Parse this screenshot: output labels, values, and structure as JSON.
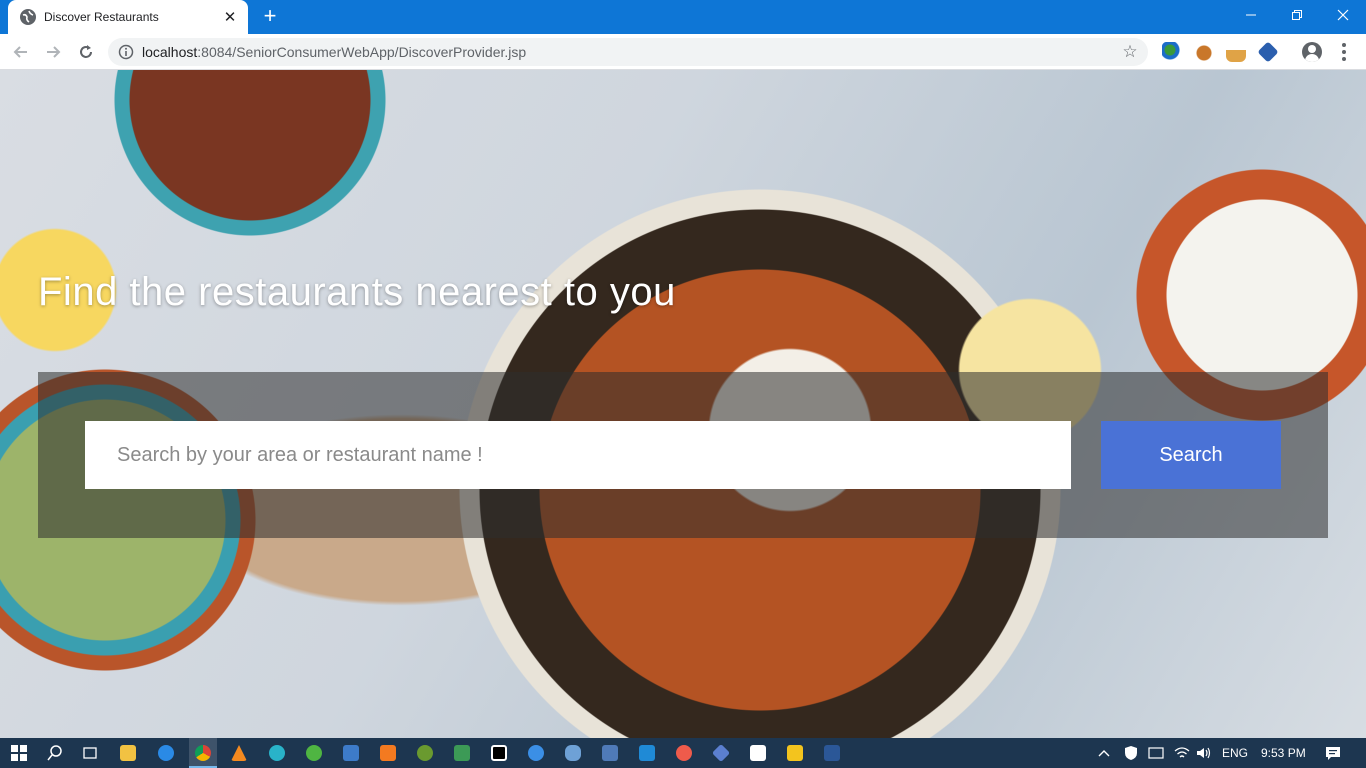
{
  "browser": {
    "tab_title": "Discover Restaurants",
    "url_host": "localhost",
    "url_rest": ":8084/SeniorConsumerWebApp/DiscoverProvider.jsp",
    "close_glyph": "✕",
    "new_tab_glyph": "+",
    "minimize_glyph": "—",
    "maximize_glyph": "❐",
    "window_close_glyph": "✕",
    "star_glyph": "☆"
  },
  "page": {
    "heading": "Find the restaurants nearest to you",
    "search_placeholder": "Search by your area or restaurant name !",
    "search_value": "",
    "search_button_label": "Search",
    "accent_color": "#4a72d6"
  },
  "taskbar": {
    "apps": [
      "windows-start-icon",
      "search-icon",
      "task-view-icon",
      "file-explorer-icon",
      "edge-icon",
      "chrome-icon",
      "vlc-icon",
      "app-icon",
      "app-icon",
      "virtualbox-icon",
      "xampp-icon",
      "app-icon",
      "app-icon",
      "intellij-icon",
      "app-icon",
      "postgres-icon",
      "app-icon",
      "vscode-icon",
      "app-icon",
      "app-icon",
      "app-icon",
      "app-icon",
      "word-icon"
    ],
    "language": "ENG",
    "time": "9:53 PM"
  }
}
